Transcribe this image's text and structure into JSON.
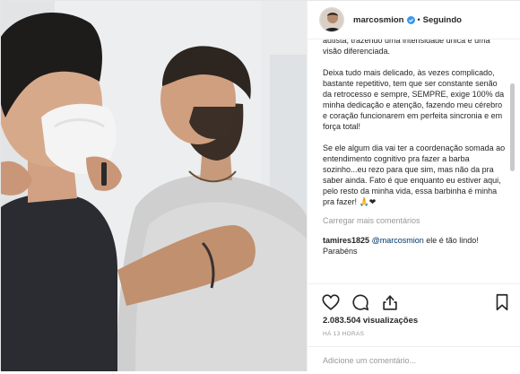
{
  "post": {
    "username": "marcosmion",
    "separator": "•",
    "follow_label": "Seguindo"
  },
  "caption": {
    "top_partial": "autista, trazendo uma intensidade única e uma visão diferenciada.",
    "paragraph2": "Deixa tudo mais delicado, às vezes complicado, bastante repetitivo, tem que ser constante senão da retrocesso e sempre, SEMPRE, exige 100% da minha dedicação e atenção, fazendo meu cérebro e coração funcionarem em perfeita sincronia e em força total!",
    "paragraph3": "Se ele algum dia vai ter a coordenação somada ao entendimento cognitivo pra fazer a barba sozinho...eu rezo para que sim, mas não da pra saber ainda. Fato é que enquanto eu estiver aqui, pelo resto da minha vida, essa barbinha é minha pra fazer! 🙏❤"
  },
  "load_more_label": "Carregar mais comentários",
  "comments": [
    {
      "user": "tamires1825",
      "mention": "@marcosmion",
      "text": " ele é tão lindo! Parabéns"
    }
  ],
  "stats": {
    "views": "2.083.504 visualizações",
    "time_ago": "HÁ 13 HORAS"
  },
  "add_comment": {
    "placeholder": "Adicione um comentário..."
  },
  "icons": {
    "like": "heart-icon",
    "comment": "comment-icon",
    "share": "share-icon",
    "save": "bookmark-icon",
    "verified": "verified-badge-icon"
  },
  "colors": {
    "verified": "#3897f0",
    "muted": "#999999",
    "mention": "#003569"
  }
}
